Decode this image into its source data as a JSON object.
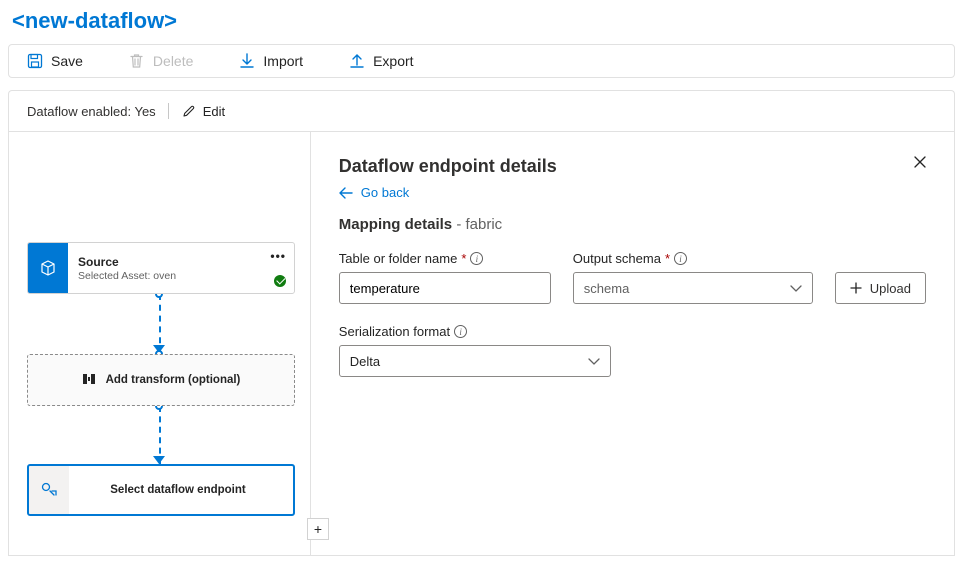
{
  "title": "<new-dataflow>",
  "toolbar": {
    "save": "Save",
    "delete": "Delete",
    "import": "Import",
    "export": "Export"
  },
  "status": {
    "label": "Dataflow enabled:",
    "value": "Yes",
    "edit": "Edit"
  },
  "canvas": {
    "source": {
      "title": "Source",
      "sub": "Selected Asset: oven"
    },
    "transform": {
      "label": "Add transform (optional)"
    },
    "endpoint": {
      "label": "Select dataflow endpoint"
    }
  },
  "detail": {
    "heading": "Dataflow endpoint details",
    "goback": "Go back",
    "subhead_main": "Mapping details",
    "subhead_sub": "fabric",
    "table_label": "Table or folder name",
    "table_value": "temperature",
    "schema_label": "Output schema",
    "schema_placeholder": "schema",
    "upload": "Upload",
    "serialization_label": "Serialization format",
    "serialization_value": "Delta"
  }
}
